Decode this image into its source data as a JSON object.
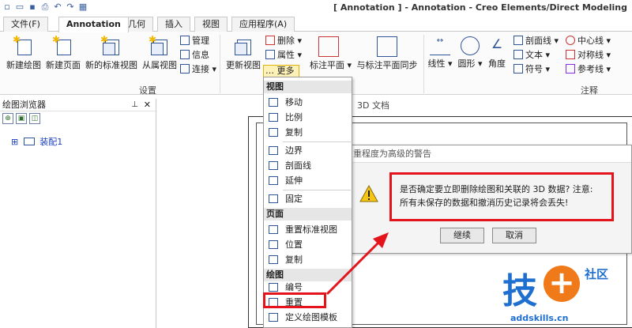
{
  "window": {
    "title": "[ Annotation ] - Annotation - Creo Elements/Direct Modeling"
  },
  "quick_access": [
    "document-new-icon",
    "folder-open-icon",
    "save-icon",
    "print-icon",
    "undo-icon",
    "redo-icon",
    "window-icon"
  ],
  "tabs": [
    {
      "label": "文件(F)",
      "active": false
    },
    {
      "label": "Annotation",
      "active": true
    },
    {
      "label": "几何",
      "active": false
    },
    {
      "label": "插入",
      "active": false
    },
    {
      "label": "视图",
      "active": false
    },
    {
      "label": "应用程序(A)",
      "active": false
    }
  ],
  "ribbon": {
    "buttons": {
      "new_drawing": "新建绘图",
      "new_page": "新建页面",
      "new_std_view": "新的标准视图",
      "dependent_view": "从属视图",
      "manage": "管理",
      "info": "信息",
      "connect": "连接",
      "update_view": "更新视图",
      "delete": "删除",
      "properties": "属性",
      "more": "更多",
      "dim_plane": "标注平面",
      "sync_dim_plane": "与标注平面同步",
      "linear": "线性",
      "circular": "圆形",
      "angle": "角度",
      "section_line": "剖面线",
      "text": "文本",
      "symbol": "符号",
      "center_line": "中心线",
      "symmetry_line": "对称线",
      "reference_line": "参考线"
    },
    "groups": {
      "setup": "设置",
      "annotation": "注释"
    }
  },
  "browser": {
    "title": "绘图浏览器",
    "tree_item": "装配1"
  },
  "canvas": {
    "tab_label": "3D 文档"
  },
  "dialog": {
    "title": "重程度为高级的警告",
    "message": "是否确定要立即删除绘图和关联的 3D 数据? 注意: 所有未保存的数据和撤消历史记录将会丢失!",
    "ok_label": "继续",
    "cancel_label": "取消"
  },
  "menu": {
    "sections": [
      {
        "label": "视图",
        "items": [
          "移动",
          "比例",
          "复制",
          "边界",
          "剖面线",
          "延伸",
          "固定"
        ]
      },
      {
        "label": "页面",
        "items": [
          "重置标准视图",
          "位置",
          "复制"
        ]
      },
      {
        "label": "绘图",
        "items": [
          "编号",
          "重置",
          "定义绘图模板"
        ]
      }
    ]
  },
  "logo": {
    "main": "技",
    "plus": "+",
    "side": "社区",
    "url": "addskills.cn"
  },
  "colors": {
    "highlight_red": "#e3141b",
    "accent_blue": "#2f5597",
    "logo_blue": "#1f6fd1",
    "logo_orange": "#f07a1a"
  }
}
